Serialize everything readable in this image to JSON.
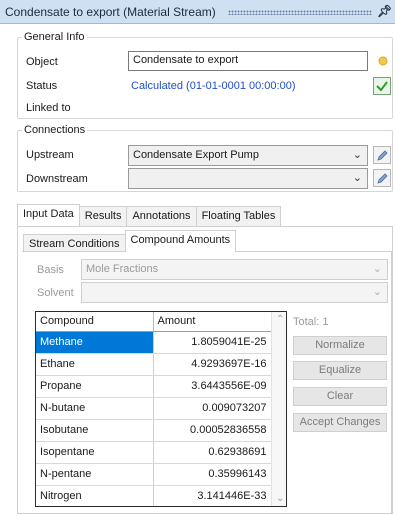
{
  "window": {
    "title": "Condensate to export (Material Stream)",
    "pin_icon": "pin-icon"
  },
  "general": {
    "group_label": "General Info",
    "object_label": "Object",
    "object_value": "Condensate to export",
    "status_label": "Status",
    "status_value": "Calculated (01-01-0001 00:00:00)",
    "linked_label": "Linked to"
  },
  "connections": {
    "group_label": "Connections",
    "upstream_label": "Upstream",
    "upstream_value": "Condensate Export Pump",
    "downstream_label": "Downstream",
    "downstream_value": ""
  },
  "main_tabs": [
    "Input Data",
    "Results",
    "Annotations",
    "Floating Tables"
  ],
  "sub_tabs": [
    "Stream Conditions",
    "Compound Amounts"
  ],
  "basis": {
    "label": "Basis",
    "value": "Mole Fractions"
  },
  "solvent": {
    "label": "Solvent",
    "value": ""
  },
  "table": {
    "headers": [
      "Compound",
      "Amount"
    ],
    "rows": [
      {
        "name": "Methane",
        "amount": "1.8059041E-25"
      },
      {
        "name": "Ethane",
        "amount": "4.9293697E-16"
      },
      {
        "name": "Propane",
        "amount": "3.6443556E-09"
      },
      {
        "name": "N-butane",
        "amount": "0.009073207"
      },
      {
        "name": "Isobutane",
        "amount": "0.00052836558"
      },
      {
        "name": "Isopentane",
        "amount": "0.62938691"
      },
      {
        "name": "N-pentane",
        "amount": "0.35996143"
      },
      {
        "name": "Nitrogen",
        "amount": "3.141446E-33"
      }
    ]
  },
  "total_label": "Total: 1",
  "buttons": {
    "normalize": "Normalize",
    "equalize": "Equalize",
    "clear": "Clear",
    "accept": "Accept Changes"
  },
  "colors": {
    "titlebar": "#cfe0f3",
    "selection": "#0078d7",
    "status_text": "#1f4fc9"
  }
}
